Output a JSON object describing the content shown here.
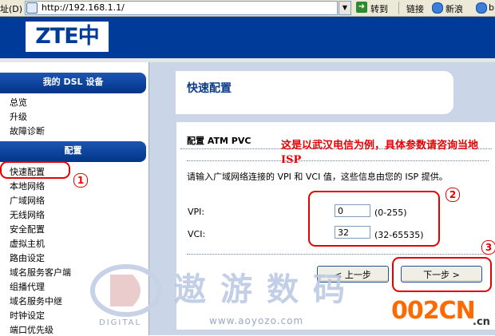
{
  "browser": {
    "address_label": "址(D)",
    "url": "http://192.168.1.1/",
    "go_label": "转到",
    "links_label": "链接",
    "xinlang_label": "新浪",
    "more_label": "b"
  },
  "header": {
    "logo_text": "ZTE中兴"
  },
  "sidebar": {
    "section1_title": "我的 DSL 设备",
    "section1_items": [
      "总览",
      "升级",
      "故障诊断"
    ],
    "section2_title": "配置",
    "section2_items": [
      "快速配置",
      "本地网络",
      "广域网络",
      "无线网络",
      "安全配置",
      "虚拟主机",
      "路由设定",
      "域名服务客户端",
      "组播代理",
      "域名服务中继",
      "时钟设定",
      "端口优先级"
    ]
  },
  "main": {
    "page_title": "快速配置",
    "section_title": "配置 ATM PVC",
    "description": "请输入广域网络连接的 VPI 和 VCI 值，这些信息由您的 ISP 提供。",
    "vpi_label": "VPI:",
    "vpi_value": "0",
    "vpi_range": "(0-255)",
    "vci_label": "VCI:",
    "vci_value": "32",
    "vci_range": "(32-65535)",
    "prev_button": "< 上一步",
    "next_button": "下一步 >"
  },
  "annotations": {
    "note": "这是以武汉电信为例，具体参数请咨询当地ISP",
    "num1": "1",
    "num2": "2",
    "num3": "3"
  },
  "watermark": {
    "cn_text": "遨游数码",
    "url": "www.aoyozo.com",
    "brand": "002CN",
    "brand_suffix": ".cn",
    "digital": "DIGITAL"
  }
}
